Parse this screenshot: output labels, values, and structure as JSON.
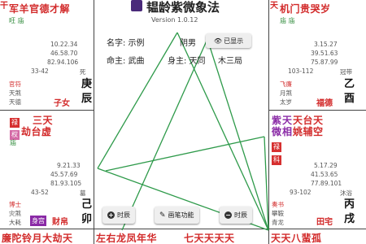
{
  "header": {
    "title": "韫龄紫微象法",
    "version": "Version 1.0.12"
  },
  "info": {
    "name": "名字: 示例",
    "gender": "阴男",
    "show_btn": "已显示",
    "ming_zhu": "命主: 武曲",
    "shen_zhu": "身主: 天同",
    "bureau": "木三局"
  },
  "palaces": {
    "si": {
      "stars_top": "军羊官德才解",
      "status": "旺 庙",
      "ages": [
        "10.22.34",
        "46.58.70",
        "82.94.106"
      ],
      "range": "33-42",
      "stage": "死",
      "minor": [
        "官符",
        "天煞",
        "天德"
      ],
      "name": "子女",
      "branch": [
        "庚",
        "辰"
      ]
    },
    "wu_right": {
      "stars_top": "机门贵哭岁",
      "status": "庙 庙",
      "ages": [
        "3.15.27",
        "39.51.63",
        "75.87.99"
      ],
      "range": "103-112",
      "stage": "冠带",
      "minor": [
        "飞廉",
        "月煞",
        "太岁"
      ],
      "name": "福德",
      "branch": [
        "乙",
        "酉"
      ]
    },
    "mao": {
      "stars_row1": "三天",
      "stars_row2": "劫台虚",
      "status": "庙",
      "ages": [
        "9.21.33",
        "45.57.69",
        "81.93.105"
      ],
      "range": "43-52",
      "stage": "墓",
      "minor": [
        "博士",
        "灾煞",
        "大耗"
      ],
      "body_tag": "身宫",
      "name": "财帛",
      "branch": [
        "己",
        "卯"
      ]
    },
    "xu": {
      "stars_row1": "天台天",
      "stars_row2": "姚辅空",
      "status": "庙 庙",
      "ages": [
        "5.17.29",
        "41.53.65",
        "77.89.101"
      ],
      "range": "93-102",
      "stage": "沐浴",
      "minor": [
        "奏书",
        "攀鞍",
        "青龙"
      ],
      "name": "田宅",
      "branch": [
        "丙",
        "戌"
      ]
    }
  },
  "hua": {
    "lu": "禄",
    "quan": "权",
    "ke": "科",
    "lu_dark": "禄",
    "zi_wei": "紫",
    "wei": "微"
  },
  "bottom": {
    "left": "廉陀铃月大劫天",
    "mid": "左右龙凤年华",
    "right1": "七天天天天",
    "right2": "天天八蜚孤"
  },
  "buttons": {
    "prev": "时辰",
    "brush": "画笔功能",
    "next": "时辰"
  },
  "colors": {
    "lu": "#d63030",
    "quan": "#d46aa6",
    "ke": "#2e8a3a",
    "accent": "#8a2aa6"
  }
}
